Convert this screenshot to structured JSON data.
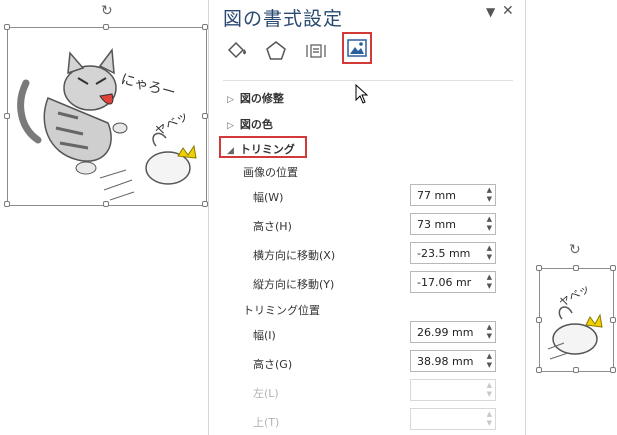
{
  "panel": {
    "title": "図の書式設定",
    "tabs": [
      {
        "name": "fill-line"
      },
      {
        "name": "effects"
      },
      {
        "name": "layout-properties"
      },
      {
        "name": "picture",
        "active": true
      }
    ]
  },
  "sections": {
    "corrections": "図の修整",
    "color": "図の色",
    "crop": "トリミング"
  },
  "image_position": {
    "heading": "画像の位置",
    "width": {
      "label": "幅(W)",
      "value": "77 mm"
    },
    "height": {
      "label": "高さ(H)",
      "value": "73 mm"
    },
    "offset_x": {
      "label": "横方向に移動(X)",
      "value": "-23.5 mm"
    },
    "offset_y": {
      "label": "縦方向に移動(Y)",
      "value": "-17.06 mr"
    }
  },
  "crop_position": {
    "heading": "トリミング位置",
    "width": {
      "label": "幅(I)",
      "value": "26.99 mm"
    },
    "height": {
      "label": "高さ(G)",
      "value": "38.98 mm"
    },
    "left": {
      "label": "左(L)",
      "value": ""
    },
    "top": {
      "label": "上(T)",
      "value": ""
    }
  },
  "image_text": {
    "cat_say": "にゃろー",
    "yabe": "ヤベッ"
  },
  "colors": {
    "highlight": "#d23a3a",
    "title": "#2a4a72"
  }
}
